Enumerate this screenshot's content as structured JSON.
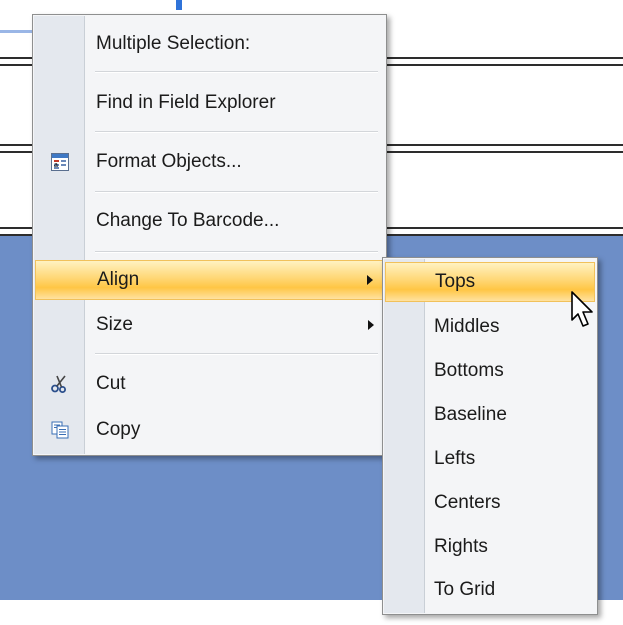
{
  "context_menu": {
    "items": [
      {
        "label": "Multiple Selection:"
      },
      {
        "label": "Find in Field Explorer"
      },
      {
        "label": "Format Objects...",
        "icon": "format-objects-icon"
      },
      {
        "label": "Change To Barcode..."
      },
      {
        "label": "Align",
        "submenu": true,
        "highlighted": true
      },
      {
        "label": "Size",
        "submenu": true
      },
      {
        "label": "Cut",
        "icon": "scissors-icon"
      },
      {
        "label": "Copy",
        "icon": "copy-icon"
      }
    ]
  },
  "align_submenu": {
    "items": [
      {
        "label": "Tops",
        "highlighted": true
      },
      {
        "label": "Middles"
      },
      {
        "label": "Bottoms"
      },
      {
        "label": "Baseline"
      },
      {
        "label": "Lefts"
      },
      {
        "label": "Centers"
      },
      {
        "label": "Rights"
      },
      {
        "label": "To Grid"
      }
    ]
  },
  "colors": {
    "canvas_blue": "#6d8ec7",
    "menu_background": "#f4f5f7",
    "highlight": "#ffc645"
  },
  "icons": [
    "format-objects-icon",
    "scissors-icon",
    "copy-icon",
    "submenu-arrow-icon",
    "mouse-pointer-icon"
  ]
}
